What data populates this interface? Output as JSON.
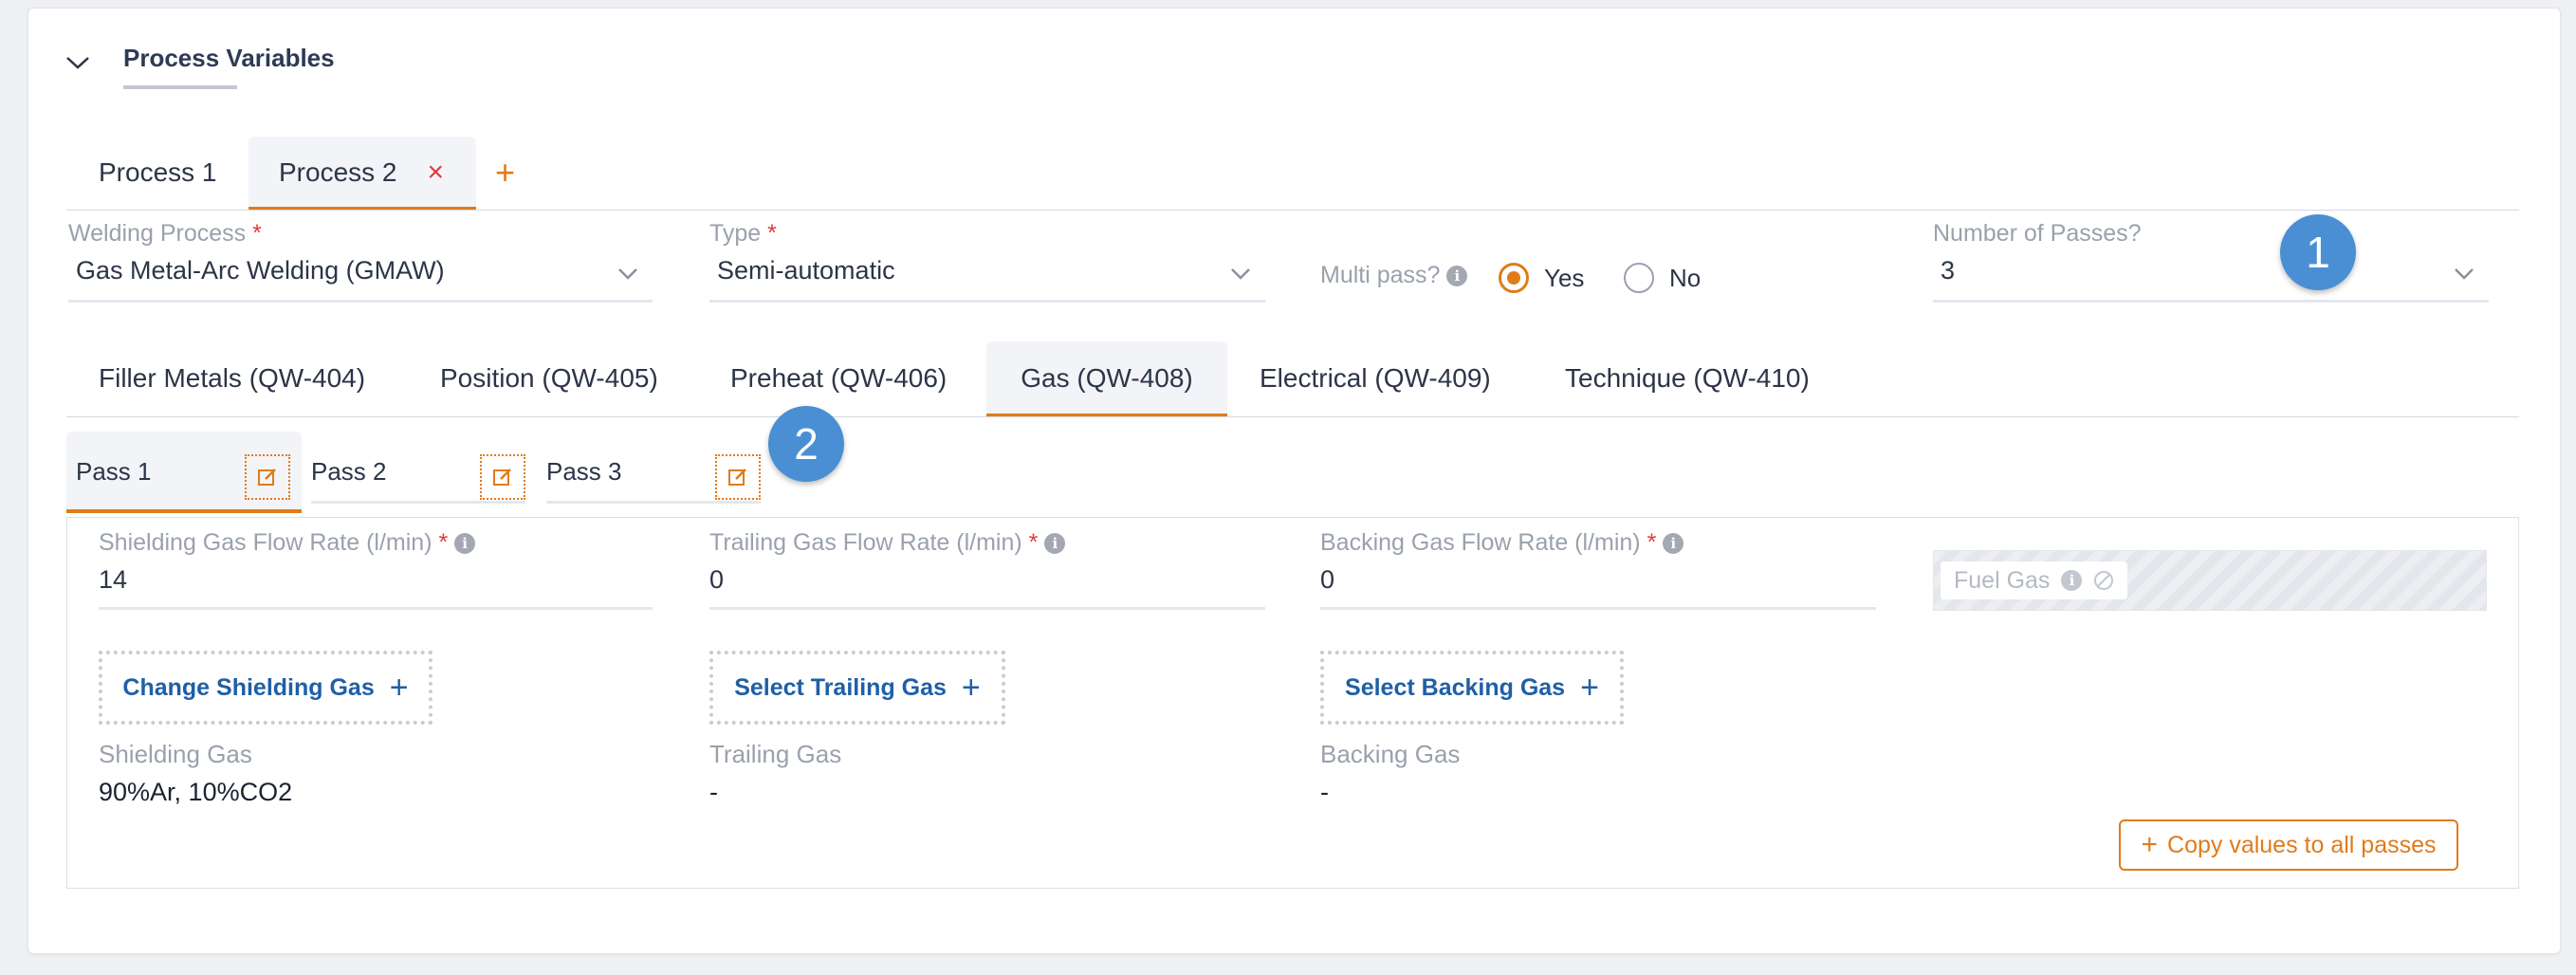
{
  "section": {
    "title": "Process Variables"
  },
  "process_tabs": [
    {
      "label": "Process 1"
    },
    {
      "label": "Process 2",
      "close": "×"
    }
  ],
  "add_tab": "+",
  "welding_process": {
    "label": "Welding Process",
    "required": "*",
    "value": "Gas Metal-Arc Welding (GMAW)"
  },
  "type": {
    "label": "Type",
    "required": "*",
    "value": "Semi-automatic"
  },
  "multi_pass": {
    "label": "Multi pass?",
    "yes": "Yes",
    "no": "No",
    "selected": "Yes"
  },
  "num_passes": {
    "label": "Number of Passes?",
    "value": "3"
  },
  "badges": {
    "one": "1",
    "two": "2"
  },
  "variable_tabs": [
    "Filler Metals (QW-404)",
    "Position (QW-405)",
    "Preheat (QW-406)",
    "Gas (QW-408)",
    "Electrical (QW-409)",
    "Technique (QW-410)"
  ],
  "pass_tabs": [
    "Pass 1",
    "Pass 2",
    "Pass 3"
  ],
  "shielding_rate": {
    "label": "Shielding Gas Flow Rate (l/min)",
    "required": "*",
    "value": "14"
  },
  "trailing_rate": {
    "label": "Trailing Gas Flow Rate (l/min)",
    "required": "*",
    "value": "0"
  },
  "backing_rate": {
    "label": "Backing Gas Flow Rate (l/min)",
    "required": "*",
    "value": "0"
  },
  "fuel_gas": {
    "label": "Fuel Gas"
  },
  "buttons": {
    "change_shielding": "Change Shielding Gas",
    "select_trailing": "Select Trailing Gas",
    "select_backing": "Select Backing Gas",
    "plus": "+"
  },
  "shielding_gas": {
    "label": "Shielding Gas",
    "value": "90%Ar, 10%CO2"
  },
  "trailing_gas": {
    "label": "Trailing Gas",
    "value": "-"
  },
  "backing_gas": {
    "label": "Backing Gas",
    "value": "-"
  },
  "copy_button": {
    "plus": "+",
    "label": "Copy values to all passes"
  },
  "colors": {
    "accent": "#e07b1a",
    "link": "#1f5fa6",
    "badge": "#4a8fd4",
    "required": "#e03a3a"
  }
}
